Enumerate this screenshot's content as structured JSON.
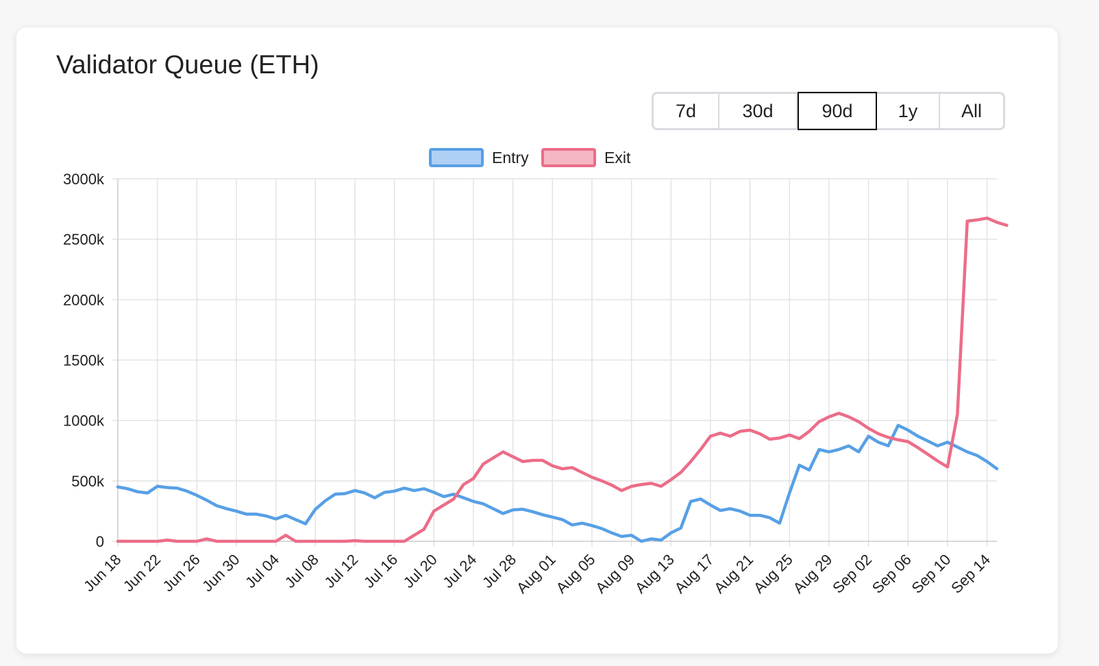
{
  "page_title": "Validator Queue (ETH)",
  "range_buttons": [
    {
      "label": "7d",
      "active": false
    },
    {
      "label": "30d",
      "active": false
    },
    {
      "label": "90d",
      "active": true
    },
    {
      "label": "1y",
      "active": false
    },
    {
      "label": "All",
      "active": false
    }
  ],
  "chart_data": {
    "type": "line",
    "title": "Validator Queue (ETH)",
    "xlabel": "",
    "ylabel": "",
    "ylim": [
      0,
      3000000
    ],
    "y_ticks": [
      0,
      500000,
      1000000,
      1500000,
      2000000,
      2500000,
      3000000
    ],
    "y_tick_labels": [
      "0",
      "500k",
      "1000k",
      "1500k",
      "2000k",
      "2500k",
      "3000k"
    ],
    "x_start": "Jun 18",
    "x_tick_labels": [
      "Jun 18",
      "Jun 22",
      "Jun 26",
      "Jun 30",
      "Jul 04",
      "Jul 08",
      "Jul 12",
      "Jul 16",
      "Jul 20",
      "Jul 24",
      "Jul 28",
      "Aug 01",
      "Aug 05",
      "Aug 09",
      "Aug 13",
      "Aug 17",
      "Aug 21",
      "Aug 25",
      "Aug 29",
      "Sep 02",
      "Sep 06",
      "Sep 10",
      "Sep 14"
    ],
    "grid": true,
    "legend_position": "top-center",
    "series": [
      {
        "name": "Entry",
        "color": "#57a0e5",
        "fill": "#afd0f5",
        "values": [
          450000,
          435000,
          410000,
          400000,
          455000,
          445000,
          440000,
          415000,
          380000,
          340000,
          295000,
          270000,
          250000,
          225000,
          225000,
          210000,
          185000,
          215000,
          180000,
          145000,
          265000,
          335000,
          390000,
          395000,
          420000,
          400000,
          360000,
          405000,
          415000,
          440000,
          420000,
          435000,
          405000,
          370000,
          390000,
          360000,
          330000,
          310000,
          270000,
          230000,
          260000,
          265000,
          245000,
          220000,
          200000,
          180000,
          135000,
          150000,
          130000,
          105000,
          70000,
          40000,
          50000,
          0,
          20000,
          10000,
          70000,
          110000,
          330000,
          350000,
          300000,
          255000,
          270000,
          250000,
          215000,
          215000,
          195000,
          150000,
          400000,
          630000,
          590000,
          760000,
          740000,
          760000,
          790000,
          740000,
          870000,
          820000,
          790000,
          960000,
          920000,
          870000,
          830000,
          790000,
          820000,
          780000,
          740000,
          710000,
          660000,
          600000
        ]
      },
      {
        "name": "Exit",
        "color": "#ec6d88",
        "fill": "#f6b7c4",
        "values": [
          0,
          0,
          0,
          0,
          0,
          10000,
          0,
          0,
          0,
          20000,
          0,
          0,
          0,
          0,
          0,
          0,
          0,
          50000,
          0,
          0,
          0,
          0,
          0,
          0,
          5000,
          0,
          0,
          0,
          0,
          0,
          50000,
          100000,
          250000,
          300000,
          350000,
          470000,
          520000,
          640000,
          690000,
          740000,
          700000,
          660000,
          670000,
          670000,
          625000,
          600000,
          610000,
          570000,
          530000,
          500000,
          465000,
          420000,
          455000,
          470000,
          480000,
          455000,
          510000,
          570000,
          660000,
          760000,
          870000,
          895000,
          870000,
          910000,
          920000,
          890000,
          845000,
          855000,
          880000,
          850000,
          910000,
          990000,
          1030000,
          1060000,
          1030000,
          990000,
          935000,
          890000,
          860000,
          840000,
          825000,
          775000,
          720000,
          665000,
          615000,
          1050000,
          2650000,
          2660000,
          2675000,
          2640000,
          2615000
        ]
      }
    ]
  }
}
